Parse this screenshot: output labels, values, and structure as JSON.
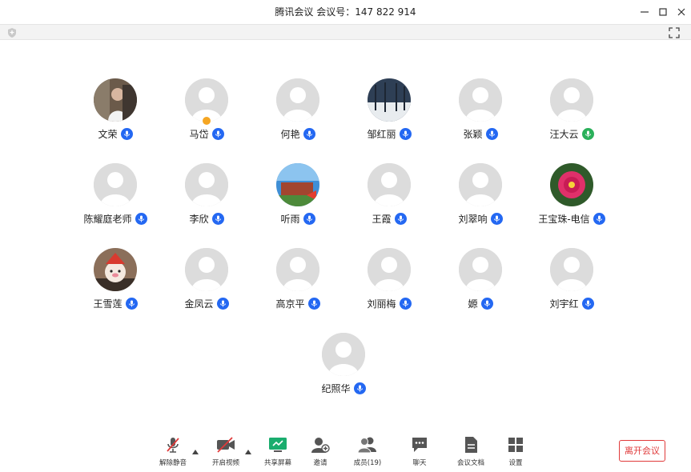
{
  "window": {
    "title": "腾讯会议 会议号：147 822 914"
  },
  "participants": [
    {
      "name": "文荣"
    },
    {
      "name": "马岱"
    },
    {
      "name": "何艳"
    },
    {
      "name": "邹红丽"
    },
    {
      "name": "张颖"
    },
    {
      "name": "汪大云"
    },
    {
      "name": "陈耀庭老师"
    },
    {
      "name": "李欣"
    },
    {
      "name": "听雨"
    },
    {
      "name": "王霞"
    },
    {
      "name": "刘翠响"
    },
    {
      "name": "王宝珠-电信"
    },
    {
      "name": "王雪莲"
    },
    {
      "name": "金凤云"
    },
    {
      "name": "高京平"
    },
    {
      "name": "刘丽梅"
    },
    {
      "name": "嫄"
    },
    {
      "name": "刘宇红"
    },
    {
      "name": "纪照华"
    }
  ],
  "toolbar": {
    "unmute": "解除静音",
    "start_video": "开启视频",
    "share_screen": "共享屏幕",
    "invite": "邀请",
    "members": "成员(19)",
    "chat": "聊天",
    "docs": "会议文档",
    "settings": "设置",
    "leave": "离开会议"
  },
  "colors": {
    "mic_blue": "#2468f2",
    "mic_green": "#2ab05a",
    "leave_red": "#e03a3a",
    "share_green": "#1aad6e"
  }
}
